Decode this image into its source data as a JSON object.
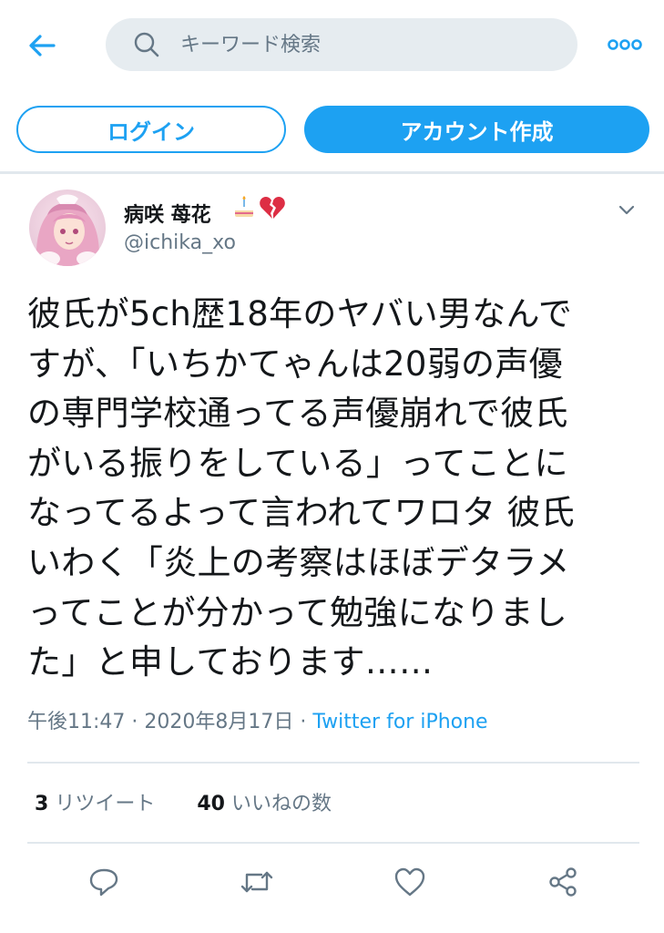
{
  "header": {
    "search_placeholder": "キーワード検索"
  },
  "auth": {
    "login_label": "ログイン",
    "signup_label": "アカウント作成"
  },
  "tweet": {
    "display_name": "病咲 苺花",
    "name_emoji": [
      "cake-icon",
      "broken-heart-icon"
    ],
    "handle": "@ichika_xo",
    "text": "彼氏が5ch歴18年のヤバい男なんで\nすが、「いちかてゃんは20弱の声優\nの専門学校通ってる声優崩れで彼氏\nがいる振りをしている」ってことに\nなってるよって言われてワロタ 彼氏\nいわく「炎上の考察はほぼデタラメ\nってことが分かって勉強になりまし\nた」と申しております……",
    "time": "午後11:47",
    "date": "2020年8月17日",
    "separator": " · ",
    "source": "Twitter for iPhone",
    "retweet_count": "3",
    "retweet_label": "リツイート",
    "like_count": "40",
    "like_label": "いいねの数"
  },
  "colors": {
    "accent": "#1da1f2",
    "muted": "#657786",
    "text": "#14171a",
    "divider": "#e1e8ed"
  }
}
